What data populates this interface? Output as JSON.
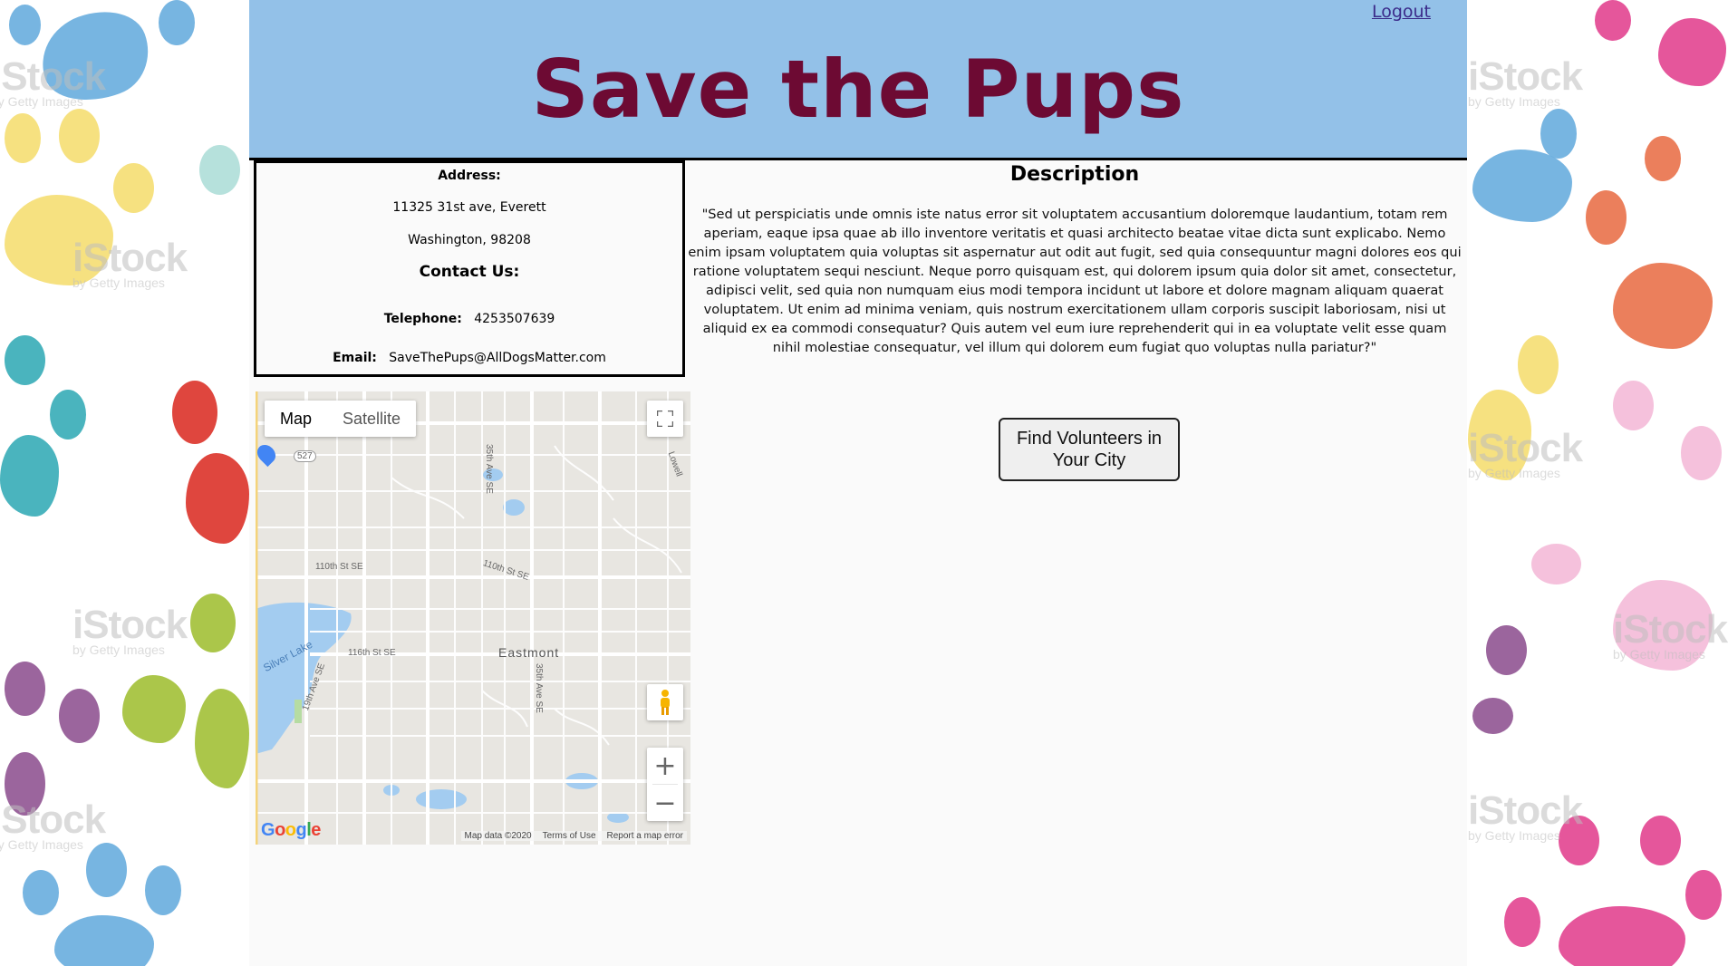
{
  "header": {
    "title": "Save the Pups",
    "logout_label": "Logout"
  },
  "address": {
    "label": "Address:",
    "street": "11325 31st ave, Everett",
    "state_zip": "Washington, 98208"
  },
  "contact": {
    "heading": "Contact Us:",
    "telephone_label": "Telephone:",
    "telephone_value": "4253507639",
    "email_label": "Email:",
    "email_value": "SaveThePups@AllDogsMatter.com"
  },
  "description": {
    "heading": "Description",
    "text": "\"Sed ut perspiciatis unde omnis iste natus error sit voluptatem accusantium doloremque laudantium, totam rem aperiam, eaque ipsa quae ab illo inventore veritatis et quasi architecto beatae vitae dicta sunt explicabo. Nemo enim ipsam voluptatem quia voluptas sit aspernatur aut odit aut fugit, sed quia consequuntur magni dolores eos qui ratione voluptatem sequi nesciunt. Neque porro quisquam est, qui dolorem ipsum quia dolor sit amet, consectetur, adipisci velit, sed quia non numquam eius modi tempora incidunt ut labore et dolore magnam aliquam quaerat voluptatem. Ut enim ad minima veniam, quis nostrum exercitationem ullam corporis suscipit laboriosam, nisi ut aliquid ex ea commodi consequatur? Quis autem vel eum iure reprehenderit qui in ea voluptate velit esse quam nihil molestiae consequatur, vel illum qui dolorem eum fugiat quo voluptas nulla pariatur?\""
  },
  "volunteer_button_label": "Find Volunteers in Your City",
  "map": {
    "tab_map": "Map",
    "tab_satellite": "Satellite",
    "labels": {
      "street_110th": "110th St SE",
      "street_110th_b": "110th St SE",
      "street_116th": "116th St SE",
      "street_35th_top": "35th Ave SE",
      "street_35th_bottom": "35th Ave SE",
      "street_19th": "19th Ave SE",
      "lake": "Silver Lake",
      "area": "Eastmont",
      "route": "527",
      "lowell": "Lowell"
    },
    "footer": {
      "map_data": "Map data ©2020",
      "terms": "Terms of Use",
      "report": "Report a map error"
    },
    "logo": "Google",
    "icons": {
      "fullscreen": "fullscreen-icon",
      "pegman": "pegman-icon",
      "zoom_in": "plus-icon",
      "zoom_out": "minus-icon"
    }
  },
  "watermark": {
    "brand": "iStock",
    "sub": "by Getty Images"
  },
  "colors": {
    "header_bg": "#93c1e8",
    "title": "#6d0a33",
    "logout": "#3b2b8a"
  }
}
